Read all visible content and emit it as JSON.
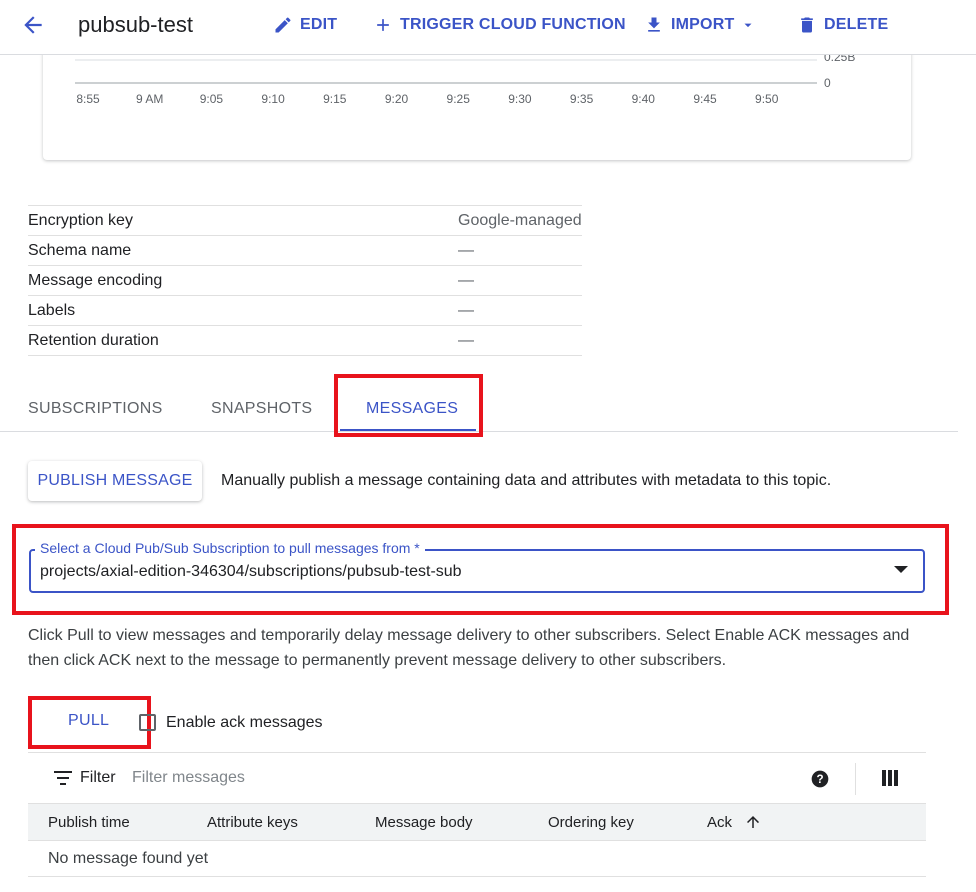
{
  "header": {
    "title": "pubsub-test",
    "back_icon": "arrow-back-icon",
    "edit_label": "EDIT",
    "trigger_label": "TRIGGER CLOUD FUNCTION",
    "import_label": "IMPORT",
    "delete_label": "DELETE"
  },
  "chart": {
    "x_ticks": [
      "8:55",
      "9 AM",
      "9:05",
      "9:10",
      "9:15",
      "9:20",
      "9:25",
      "9:30",
      "9:35",
      "9:40",
      "9:45",
      "9:50"
    ],
    "y_ticks": [
      "0.25B",
      "0"
    ]
  },
  "properties": [
    {
      "key": "Encryption key",
      "value": "Google-managed"
    },
    {
      "key": "Schema name",
      "value": "—"
    },
    {
      "key": "Message encoding",
      "value": "—"
    },
    {
      "key": "Labels",
      "value": "—"
    },
    {
      "key": "Retention duration",
      "value": "—"
    }
  ],
  "tabs": {
    "subscriptions": "SUBSCRIPTIONS",
    "snapshots": "SNAPSHOTS",
    "messages": "MESSAGES",
    "active": "messages"
  },
  "publish": {
    "button_label": "PUBLISH MESSAGE",
    "description": "Manually publish a message containing data and attributes with metadata to this topic."
  },
  "subscription_select": {
    "label": "Select a Cloud Pub/Sub Subscription to pull messages from *",
    "value": "projects/axial-edition-346304/subscriptions/pubsub-test-sub"
  },
  "help_text": "Click Pull to view messages and temporarily delay message delivery to other subscribers. Select Enable ACK messages and then click ACK next to the message to permanently prevent message delivery to other subscribers.",
  "pull": {
    "button_label": "PULL",
    "enable_ack_label": "Enable ack messages",
    "enable_ack_checked": false
  },
  "table": {
    "filter_label": "Filter",
    "filter_placeholder": "Filter messages",
    "columns": [
      "Publish time",
      "Attribute keys",
      "Message body",
      "Ordering key",
      "Ack"
    ],
    "empty_text": "No message found yet"
  },
  "colors": {
    "accent": "#3b54c7",
    "highlight": "#e8131c"
  }
}
